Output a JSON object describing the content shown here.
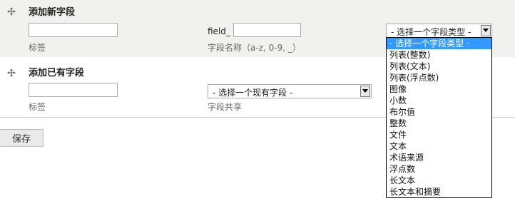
{
  "add_new_field": {
    "title": "添加新字段",
    "label_input_value": "",
    "label_caption": "标签",
    "field_prefix": "field_",
    "field_name_value": "",
    "field_name_caption": "字段名称（a-z, 0-9, _）",
    "type_select": {
      "selected": "- 选择一个字段类型 -",
      "options": [
        "- 选择一个字段类型 -",
        "列表(整数)",
        "列表(文本)",
        "列表(浮点数)",
        "图像",
        "小数",
        "布尔值",
        "整数",
        "文件",
        "文本",
        "术语来源",
        "浮点数",
        "长文本",
        "长文本和摘要"
      ]
    }
  },
  "add_existing_field": {
    "title": "添加已有字段",
    "label_input_value": "",
    "label_caption": "标签",
    "existing_select": {
      "selected": "- 选择一个现有字段 -"
    },
    "existing_caption": "字段共享"
  },
  "save_button": {
    "label": "保存"
  }
}
